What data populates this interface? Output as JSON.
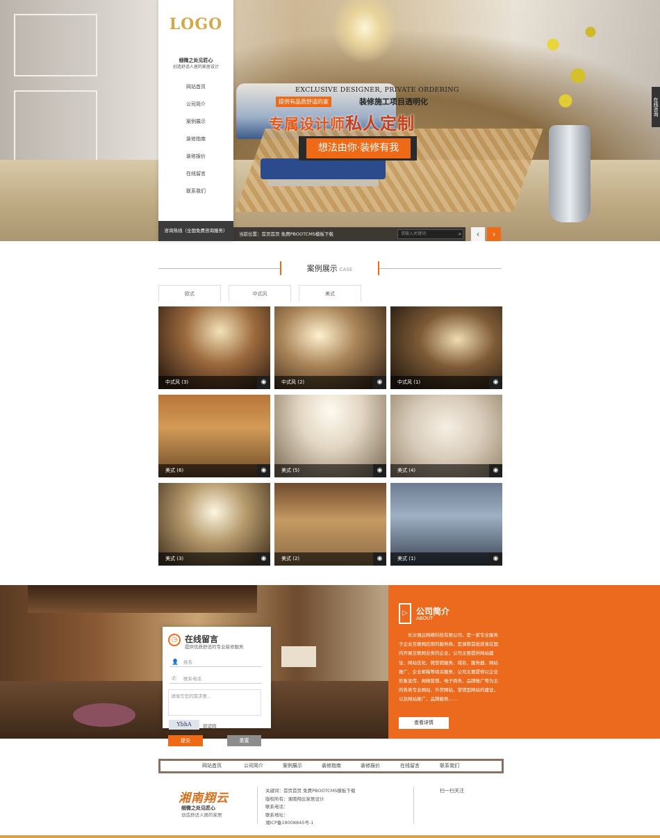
{
  "hero": {
    "logo": "LOGO",
    "slogan_line1": "细微之处见匠心",
    "slogan_line2": "创造舒适人居的家居设计",
    "menu": [
      "网站首页",
      "公司简介",
      "案例展示",
      "装修指南",
      "装修报价",
      "在线留言",
      "联系我们"
    ],
    "hotline": "咨询热线（全国免费咨询服务）",
    "side_tab": "在线咨询",
    "english_line": "EXCLUSIVE DESIGNER, PRIVATE ORDERING",
    "tag_orange": "提供有品质舒适的家",
    "tag_dark": "装修施工项目透明化",
    "headline_a": "专属设计师",
    "headline_b": "私人定制",
    "cta": "想法由你·装修有我",
    "breadcrumb": "当前位置：首页首页 免费PBOOTCMS模板下载",
    "search_placeholder": "请输入关键词",
    "search_icon": "search-icon",
    "prev_label": "‹",
    "next_label": "›"
  },
  "cases": {
    "title": "案例展示",
    "title_en": "CASE",
    "tabs": [
      "欧式",
      "中式风",
      "美式"
    ],
    "items": [
      {
        "label": "中式风 (3)",
        "icon": "qq-icon"
      },
      {
        "label": "中式风 (2)",
        "icon": "qq-icon"
      },
      {
        "label": "中式风 (1)",
        "icon": "qq-icon"
      },
      {
        "label": "美式 (6)",
        "icon": "qq-icon"
      },
      {
        "label": "美式 (5)",
        "icon": "qq-icon"
      },
      {
        "label": "美式 (4)",
        "icon": "qq-icon"
      },
      {
        "label": "美式 (3)",
        "icon": "qq-icon"
      },
      {
        "label": "美式 (2)",
        "icon": "qq-icon"
      },
      {
        "label": "美式 (1)",
        "icon": "qq-icon"
      }
    ]
  },
  "message": {
    "title": "在线留言",
    "subtitle": "提供优质舒适的专业装修服务",
    "name_placeholder": "姓名",
    "phone_placeholder": "联系电话",
    "content_placeholder": "请填写您的需求要...",
    "captcha": "YbhA",
    "captcha_label": "验证码",
    "submit": "提交",
    "reset": "重置"
  },
  "about": {
    "title": "公司简介",
    "subtitle": "ABOUT",
    "text": "长沙湘云网络科技有限公司，是一家专业服务于企业互联网应用的服务商，是湖南首批获准在国内开展互联网业务的企业，公司主要提供网站建设、网站优化、微营销服务、域名、服务器、网站推广、企业邮箱等相关服务，公司主要提供以企业形象宣传、网络营销、电子商务、品牌推广等为主的各类专业网站、外贸网站、营销型网站的建设，以及网站推广、品牌服务……",
    "more": "查看详情"
  },
  "footer": {
    "nav": [
      "网站首页",
      "公司简介",
      "案例展示",
      "装修指南",
      "装修报价",
      "在线留言",
      "联系我们"
    ],
    "logo": "湘南翔云",
    "slogan1": "细微之处见匠心",
    "slogan2": "创造舒适人居的家居",
    "info": [
      "关键词：首页首页 免费PBOOTCMS模板下载",
      "版权所有：湘南翔云家居设计",
      "联系电话：",
      "联系地址：",
      "湘ICP备18008845号-1"
    ],
    "qr_alt": "扫一扫关注"
  },
  "colors": {
    "accent": "#ef6a16",
    "dark": "#3b3b3b"
  }
}
